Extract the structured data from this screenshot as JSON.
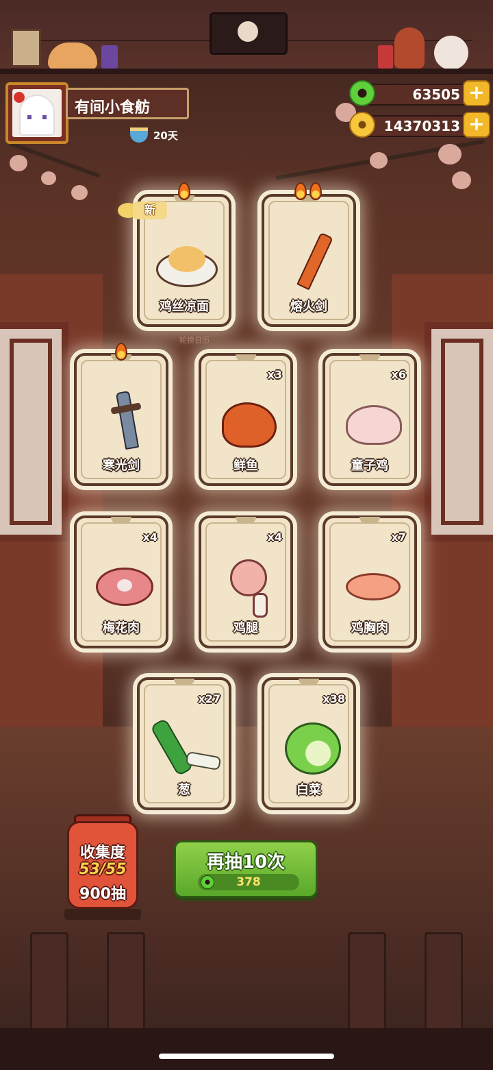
{
  "profile": {
    "shop_name": "有间小食舫",
    "days": "20天"
  },
  "currency": {
    "jade": "63505",
    "coins": "14370313"
  },
  "calendar_text": "轮换日历",
  "new_badge": "新",
  "cards": [
    {
      "id": "c1",
      "label": "鸡丝凉面",
      "count": "",
      "flames": 1,
      "icon": "noodle-dish-icon",
      "is_new": true
    },
    {
      "id": "c2",
      "label": "熔火剑",
      "count": "",
      "flames": 2,
      "icon": "fire-sword-icon"
    },
    {
      "id": "c3",
      "label": "寒光剑",
      "count": "",
      "flames": 1,
      "icon": "steel-sword-icon"
    },
    {
      "id": "c4",
      "label": "鲜鱼",
      "count": "x3",
      "flames": 0,
      "icon": "fish-icon"
    },
    {
      "id": "c5",
      "label": "童子鸡",
      "count": "x6",
      "flames": 0,
      "icon": "chicken-icon"
    },
    {
      "id": "c6",
      "label": "梅花肉",
      "count": "x4",
      "flames": 0,
      "icon": "pork-icon"
    },
    {
      "id": "c7",
      "label": "鸡腿",
      "count": "x4",
      "flames": 0,
      "icon": "drumstick-icon"
    },
    {
      "id": "c8",
      "label": "鸡胸肉",
      "count": "x7",
      "flames": 0,
      "icon": "chicken-breast-icon"
    },
    {
      "id": "c9",
      "label": "葱",
      "count": "x27",
      "flames": 0,
      "icon": "scallion-icon"
    },
    {
      "id": "c10",
      "label": "白菜",
      "count": "x38",
      "flames": 0,
      "icon": "cabbage-icon"
    }
  ],
  "collection": {
    "title": "收集度",
    "progress": "53/55",
    "pulls": "900抽"
  },
  "draw_again": {
    "label": "再抽10次",
    "cost": "378"
  },
  "colors": {
    "button_green": "#6dbb33",
    "lantern_red": "#e2543a",
    "gold": "#f2b82a"
  }
}
